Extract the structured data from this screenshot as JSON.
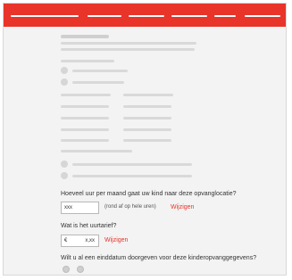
{
  "colors": {
    "brand_red": "#e9342a",
    "placeholder_gray": "#d9d9d9",
    "background": "#f3f3f3"
  },
  "questions": {
    "hours_label": "Hoeveel uur per maand gaat uw kind naar deze opvanglocatie?",
    "hours_input_value": "xxx",
    "hours_hint": "(rond af op hele uren)",
    "hours_change_link": "Wijzigen",
    "rate_label": "Wat is het uurtarief?",
    "rate_currency": "€",
    "rate_input_value": "x,xx",
    "rate_change_link": "Wijzigen",
    "end_date_label": "Wilt u al een einddatum doorgeven voor deze kinderopvanggegevens?"
  }
}
